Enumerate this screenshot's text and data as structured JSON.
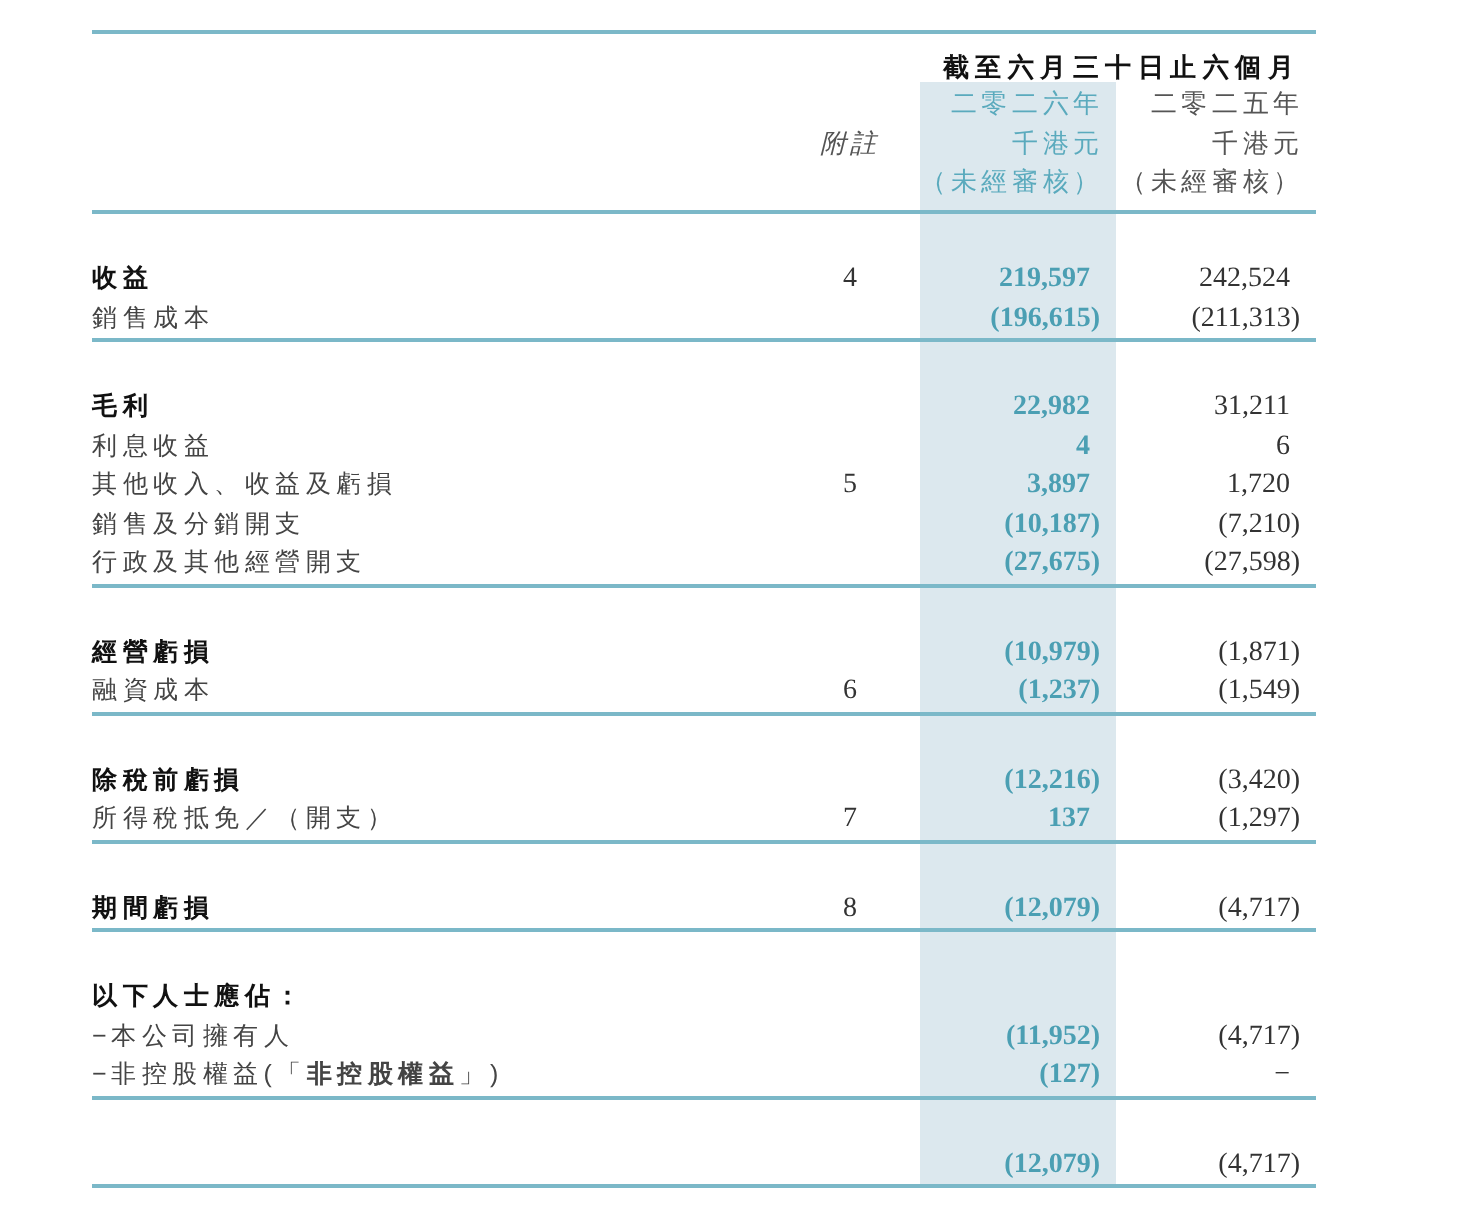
{
  "header": {
    "period": "截至六月三十日止六個月",
    "note_label": "附註",
    "columns": [
      {
        "year": "二零二六年",
        "unit": "千港元",
        "audit": "（未經審核）",
        "current": true
      },
      {
        "year": "二零二五年",
        "unit": "千港元",
        "audit": "（未經審核）",
        "current": false
      }
    ]
  },
  "sections": [
    {
      "rows": [
        {
          "label": "收益",
          "bold": true,
          "note": "4",
          "values": [
            "219,597",
            "242,524"
          ]
        },
        {
          "label": "銷售成本",
          "bold": false,
          "values": [
            "(196,615)",
            "(211,313)"
          ]
        }
      ]
    },
    {
      "rows": [
        {
          "label": "毛利",
          "bold": true,
          "values": [
            "22,982",
            "31,211"
          ]
        },
        {
          "label": "利息收益",
          "bold": false,
          "values": [
            "4",
            "6"
          ]
        },
        {
          "label": "其他收入、收益及虧損",
          "bold": false,
          "note": "5",
          "values": [
            "3,897",
            "1,720"
          ]
        },
        {
          "label": "銷售及分銷開支",
          "bold": false,
          "values": [
            "(10,187)",
            "(7,210)"
          ]
        },
        {
          "label": "行政及其他經營開支",
          "bold": false,
          "values": [
            "(27,675)",
            "(27,598)"
          ]
        }
      ]
    },
    {
      "rows": [
        {
          "label": "經營虧損",
          "bold": true,
          "values": [
            "(10,979)",
            "(1,871)"
          ]
        },
        {
          "label": "融資成本",
          "bold": false,
          "note": "6",
          "values": [
            "(1,237)",
            "(1,549)"
          ]
        }
      ]
    },
    {
      "rows": [
        {
          "label": "除稅前虧損",
          "bold": true,
          "values": [
            "(12,216)",
            "(3,420)"
          ]
        },
        {
          "label": "所得稅抵免／（開支）",
          "bold": false,
          "note": "7",
          "values": [
            "137",
            "(1,297)"
          ]
        }
      ]
    },
    {
      "rows": [
        {
          "label": "期間虧損",
          "bold": true,
          "note": "8",
          "values": [
            "(12,079)",
            "(4,717)"
          ]
        }
      ]
    },
    {
      "rows": [
        {
          "label": "以下人士應佔：",
          "bold": true,
          "values": []
        },
        {
          "label": "−本公司擁有人",
          "bold": false,
          "values": [
            "(11,952)",
            "(4,717)"
          ]
        },
        {
          "label": "−非控股權益(「**非控股權益**」)",
          "bold": false,
          "values": [
            "(127)",
            "−"
          ]
        }
      ]
    },
    {
      "rows": [
        {
          "values": [
            "(12,079)",
            "(4,717)"
          ]
        }
      ]
    }
  ]
}
